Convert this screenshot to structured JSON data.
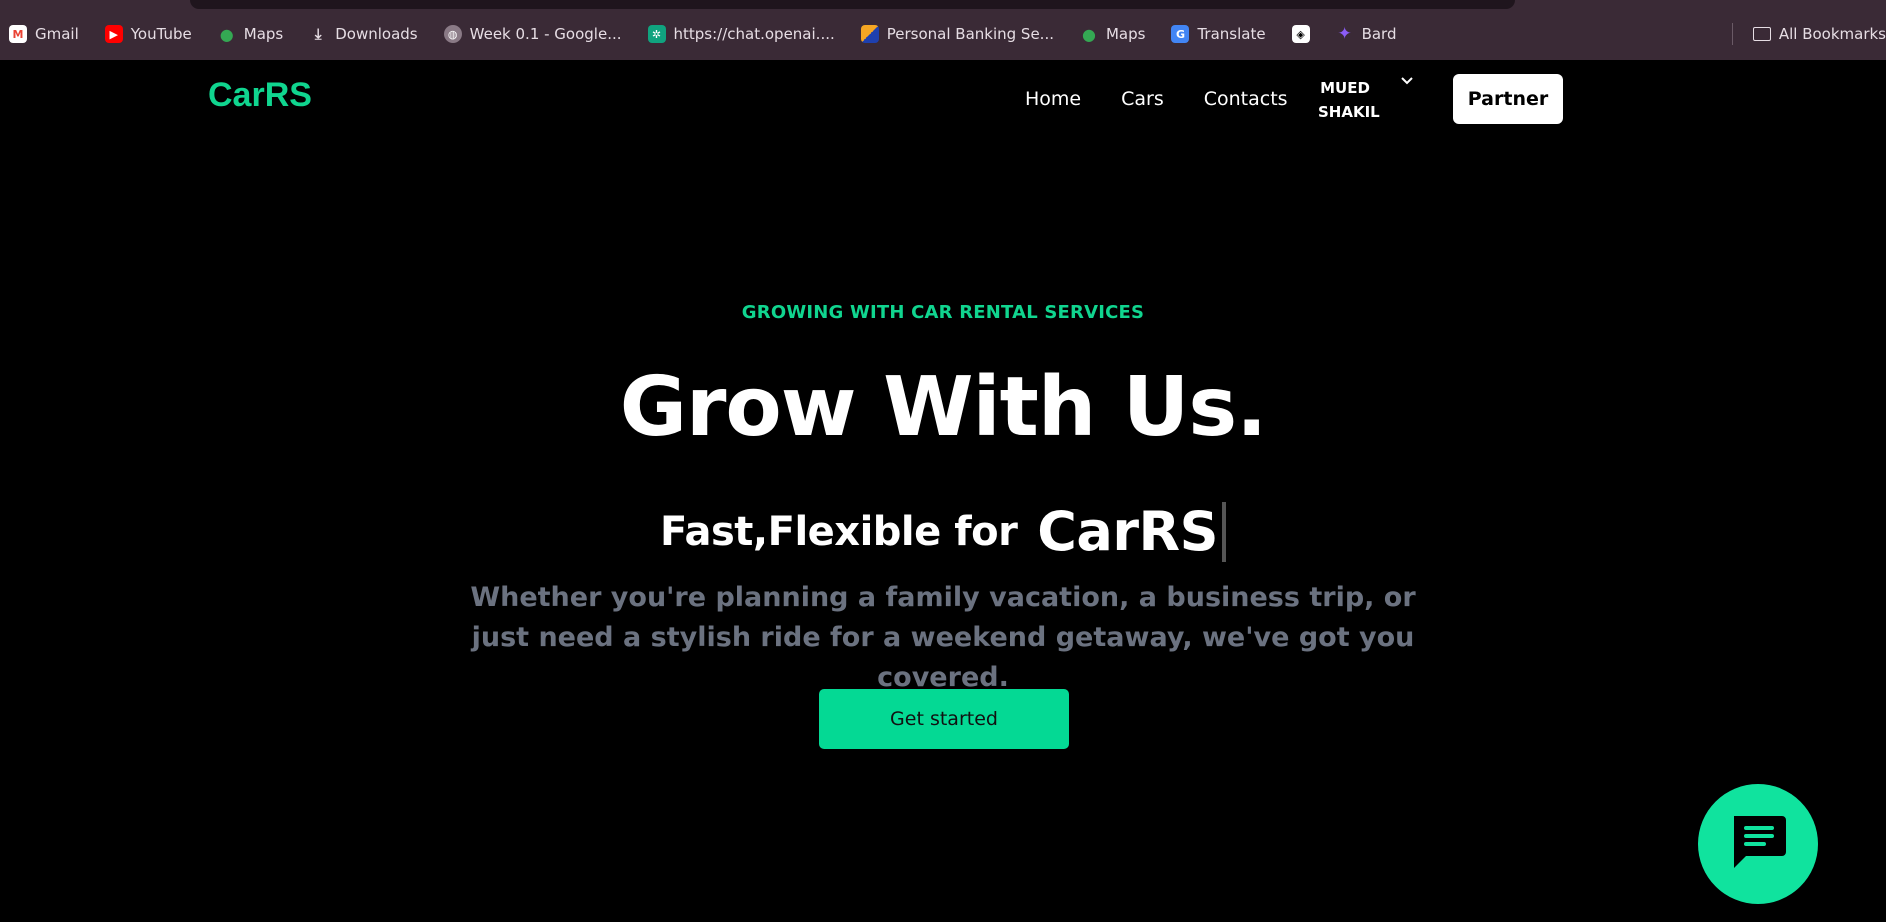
{
  "browser": {
    "bookmarks": [
      {
        "label": "Gmail",
        "icon": "gmail-icon",
        "color": "#ea4335"
      },
      {
        "label": "YouTube",
        "icon": "youtube-icon",
        "color": "#ff0000"
      },
      {
        "label": "Maps",
        "icon": "maps-icon",
        "color": "#34a853"
      },
      {
        "label": "Downloads",
        "icon": "download-icon",
        "color": "#3a2a36"
      },
      {
        "label": "Week 0.1 - Google...",
        "icon": "globe-icon",
        "color": "#8a7a86"
      },
      {
        "label": "https://chat.openai....",
        "icon": "openai-icon",
        "color": "#10a37f"
      },
      {
        "label": "Personal Banking Se...",
        "icon": "bank-icon",
        "color": "#f5a623"
      },
      {
        "label": "Maps",
        "icon": "maps-icon",
        "color": "#34a853"
      },
      {
        "label": "Translate",
        "icon": "translate-icon",
        "color": "#4285f4"
      },
      {
        "label": "",
        "icon": "codepen-icon",
        "color": "#ffffff"
      },
      {
        "label": "Bard",
        "icon": "bard-icon",
        "color": "#8b5cf6"
      }
    ],
    "all_bookmarks": "All Bookmarks"
  },
  "navbar": {
    "logo": "CarRS",
    "links": [
      "Home",
      "Cars",
      "Contacts"
    ],
    "user_first": "MUED",
    "user_last": "SHAKIL",
    "partner_label": "Partner"
  },
  "hero": {
    "eyebrow": "GROWING WITH CAR RENTAL SERVICES",
    "title": "Grow With Us.",
    "typed_static": "Fast,Flexible for",
    "typed_word": "CarRS",
    "description": "Whether you're planning a family vacation, a business trip, or just need a stylish ride for a weekend getaway, we've got you covered.",
    "cta_label": "Get started"
  },
  "colors": {
    "accent": "#10d58f",
    "cta": "#04d994",
    "background": "#000000",
    "muted_text": "#6b7280"
  }
}
